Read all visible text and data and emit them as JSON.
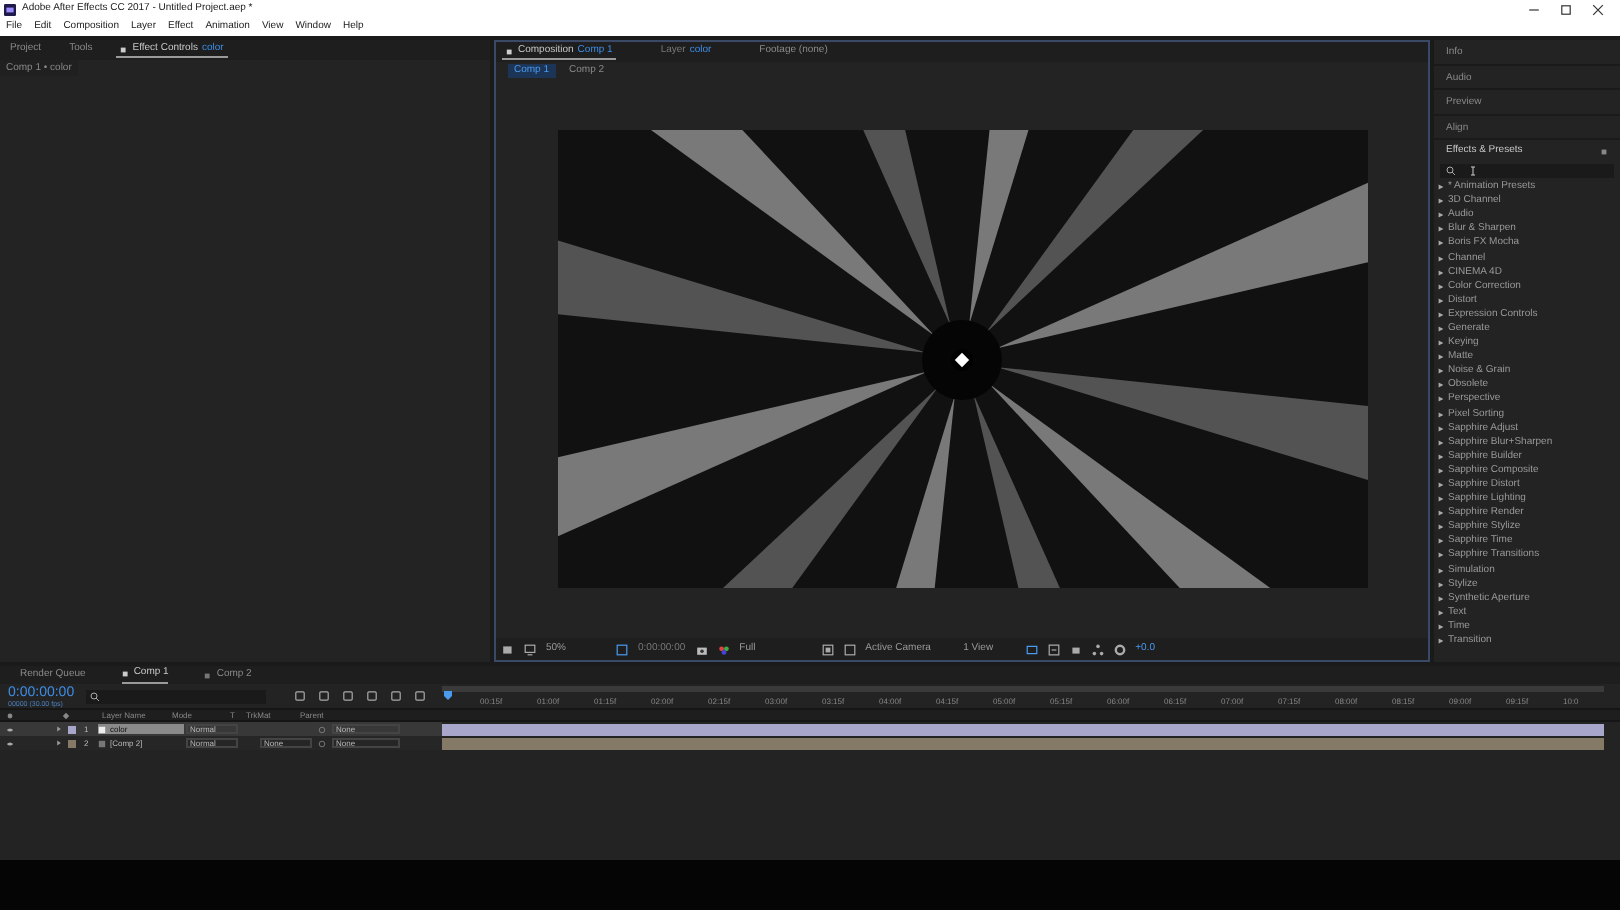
{
  "window": {
    "title": "Adobe After Effects CC 2017 - Untitled Project.aep *"
  },
  "menu": [
    "File",
    "Edit",
    "Composition",
    "Layer",
    "Effect",
    "Animation",
    "View",
    "Window",
    "Help"
  ],
  "left_panel": {
    "tabs": [
      {
        "label": "Project",
        "selected": false
      },
      {
        "label": "Tools",
        "selected": false
      },
      {
        "label": "Effect Controls",
        "target": "color",
        "selected": true
      }
    ],
    "breadcrumb": "Comp 1 • color"
  },
  "viewer": {
    "tabs": [
      {
        "label": "Composition",
        "target": "Comp 1",
        "selected": true
      },
      {
        "label": "Layer",
        "target": "color",
        "selected": false
      },
      {
        "label": "Footage (none)",
        "selected": false
      }
    ],
    "subtabs": [
      {
        "label": "Comp 1",
        "selected": true
      },
      {
        "label": "Comp 2",
        "selected": false
      }
    ],
    "toolbar": {
      "zoom": "50%",
      "timecode": "0:00:00:00",
      "resolution": "Full",
      "camera": "Active Camera",
      "views": "1 View",
      "exposure": "+0.0"
    }
  },
  "right_panel": {
    "sections": [
      "Info",
      "Audio",
      "Preview",
      "Align"
    ],
    "effects_title": "Effects & Presets",
    "effects": [
      "* Animation Presets",
      "3D Channel",
      "Audio",
      "Blur & Sharpen",
      "Boris FX Mocha",
      "Channel",
      "CINEMA 4D",
      "Color Correction",
      "Distort",
      "Expression Controls",
      "Generate",
      "Keying",
      "Matte",
      "Noise & Grain",
      "Obsolete",
      "Perspective",
      "Pixel Sorting",
      "Sapphire Adjust",
      "Sapphire Blur+Sharpen",
      "Sapphire Builder",
      "Sapphire Composite",
      "Sapphire Distort",
      "Sapphire Lighting",
      "Sapphire Render",
      "Sapphire Stylize",
      "Sapphire Time",
      "Sapphire Transitions",
      "Simulation",
      "Stylize",
      "Synthetic Aperture",
      "Text",
      "Time",
      "Transition"
    ]
  },
  "timeline": {
    "tabs": [
      {
        "label": "Render Queue",
        "selected": false
      },
      {
        "label": "Comp 1",
        "selected": true
      },
      {
        "label": "Comp 2",
        "selected": false
      }
    ],
    "timecode": "0:00:00:00",
    "frame_info": "00000 (30.00 fps)",
    "columns": [
      "Layer Name",
      "Mode",
      "T",
      "TrkMat",
      "Parent"
    ],
    "layers": [
      {
        "index": "1",
        "name": "color",
        "color": "#a9a6cc",
        "mode": "Normal",
        "parent": "None",
        "selected": true
      },
      {
        "index": "2",
        "name": "[Comp 2]",
        "color": "#857a66",
        "mode": "Normal",
        "trkmat": "None",
        "parent": "None",
        "selected": false
      }
    ],
    "ruler": [
      "00:15f",
      "01:00f",
      "01:15f",
      "02:00f",
      "02:15f",
      "03:00f",
      "03:15f",
      "04:00f",
      "04:15f",
      "05:00f",
      "05:15f",
      "06:00f",
      "06:15f",
      "07:00f",
      "07:15f",
      "08:00f",
      "08:15f",
      "09:00f",
      "09:15f",
      "10:0"
    ]
  }
}
